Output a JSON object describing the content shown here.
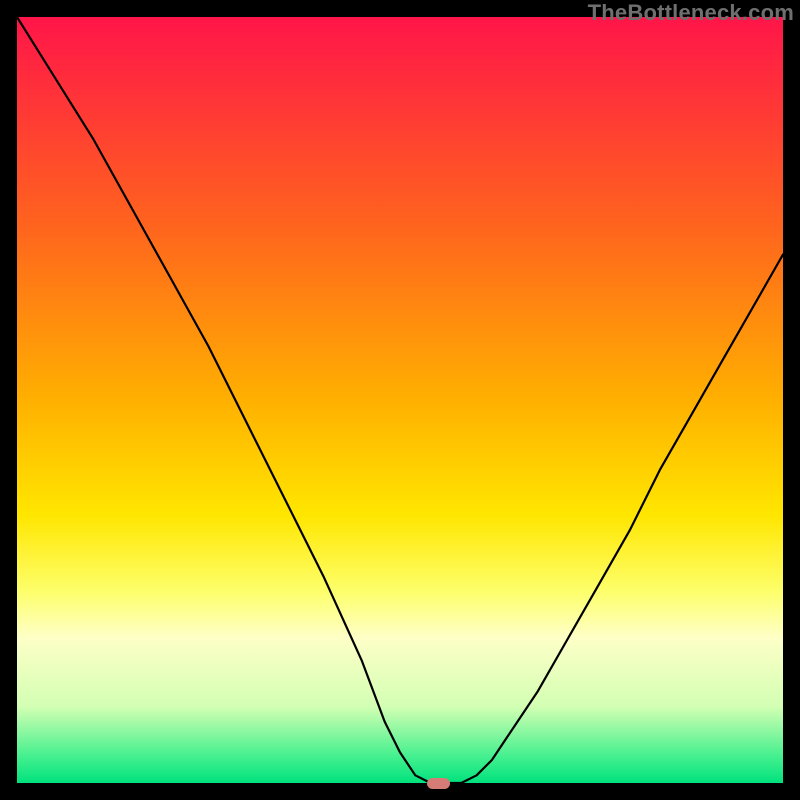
{
  "watermark": "TheBottleneck.com",
  "colors": {
    "frame": "#000000",
    "curve": "#000000",
    "marker": "#d67c76",
    "gradient_top": "#ff1549",
    "gradient_bottom": "#00e27d"
  },
  "chart_data": {
    "type": "line",
    "title": "",
    "xlabel": "",
    "ylabel": "",
    "xlim": [
      0,
      100
    ],
    "ylim": [
      0,
      100
    ],
    "grid": false,
    "legend": false,
    "series": [
      {
        "name": "curve",
        "x": [
          0,
          5,
          10,
          15,
          20,
          25,
          30,
          35,
          40,
          45,
          48,
          50,
          52,
          54,
          56,
          58,
          60,
          62,
          64,
          68,
          72,
          76,
          80,
          84,
          88,
          92,
          96,
          100
        ],
        "values": [
          100,
          92,
          84,
          75,
          66,
          57,
          47,
          37,
          27,
          16,
          8,
          4,
          1,
          0,
          0,
          0,
          1,
          3,
          6,
          12,
          19,
          26,
          33,
          41,
          48,
          55,
          62,
          69
        ]
      }
    ],
    "marker": {
      "x_center": 55,
      "y": 0,
      "width_pct": 3
    }
  }
}
